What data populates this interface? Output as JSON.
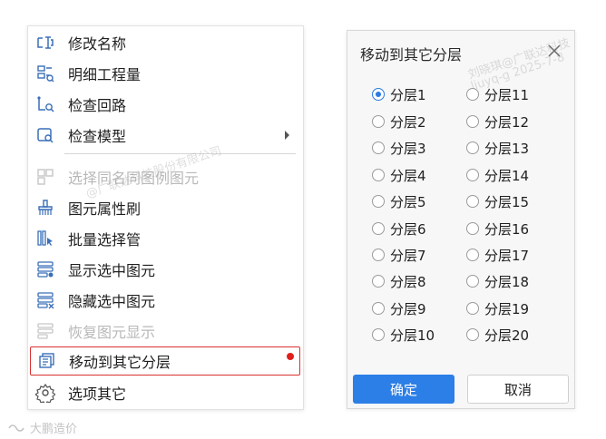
{
  "menu": {
    "items": [
      {
        "label": "修改名称",
        "icon": "rename-icon",
        "disabled": false
      },
      {
        "label": "明细工程量",
        "icon": "quantity-detail-icon",
        "disabled": false
      },
      {
        "label": "检查回路",
        "icon": "check-circuit-icon",
        "disabled": false
      },
      {
        "label": "检查模型",
        "icon": "check-model-icon",
        "disabled": false,
        "submenu": true
      },
      {
        "label": "选择同名同图例图元",
        "icon": "select-same-icon",
        "disabled": true
      },
      {
        "label": "图元属性刷",
        "icon": "property-brush-icon",
        "disabled": false
      },
      {
        "label": "批量选择管",
        "icon": "batch-select-pipe-icon",
        "disabled": false
      },
      {
        "label": "显示选中图元",
        "icon": "show-selected-icon",
        "disabled": false
      },
      {
        "label": "隐藏选中图元",
        "icon": "hide-selected-icon",
        "disabled": false
      },
      {
        "label": "恢复图元显示",
        "icon": "restore-display-icon",
        "disabled": true
      },
      {
        "label": "移动到其它分层",
        "icon": "move-layer-icon",
        "disabled": false,
        "highlighted": true
      },
      {
        "label": "选项其它",
        "icon": "gear-icon",
        "disabled": false
      }
    ]
  },
  "dialog": {
    "title": "移动到其它分层",
    "layers_left": [
      "分层1",
      "分层2",
      "分层3",
      "分层4",
      "分层5",
      "分层6",
      "分层7",
      "分层8",
      "分层9",
      "分层10"
    ],
    "layers_right": [
      "分层11",
      "分层12",
      "分层13",
      "分层14",
      "分层15",
      "分层16",
      "分层17",
      "分层18",
      "分层19",
      "分层20"
    ],
    "selected": "分层1",
    "ok_label": "确定",
    "cancel_label": "取消"
  },
  "watermark": {
    "menu_text": "@广联达科技股份有限公司",
    "dialog_text": "刘晓琪@广联达科技",
    "dialog_text2": "liuyq-g 2025-7-8"
  },
  "footer": {
    "brand": "大鹏造价"
  },
  "colors": {
    "accent": "#2c7fe6",
    "highlight_border": "#d9312f",
    "red_dot": "#e0201c"
  }
}
